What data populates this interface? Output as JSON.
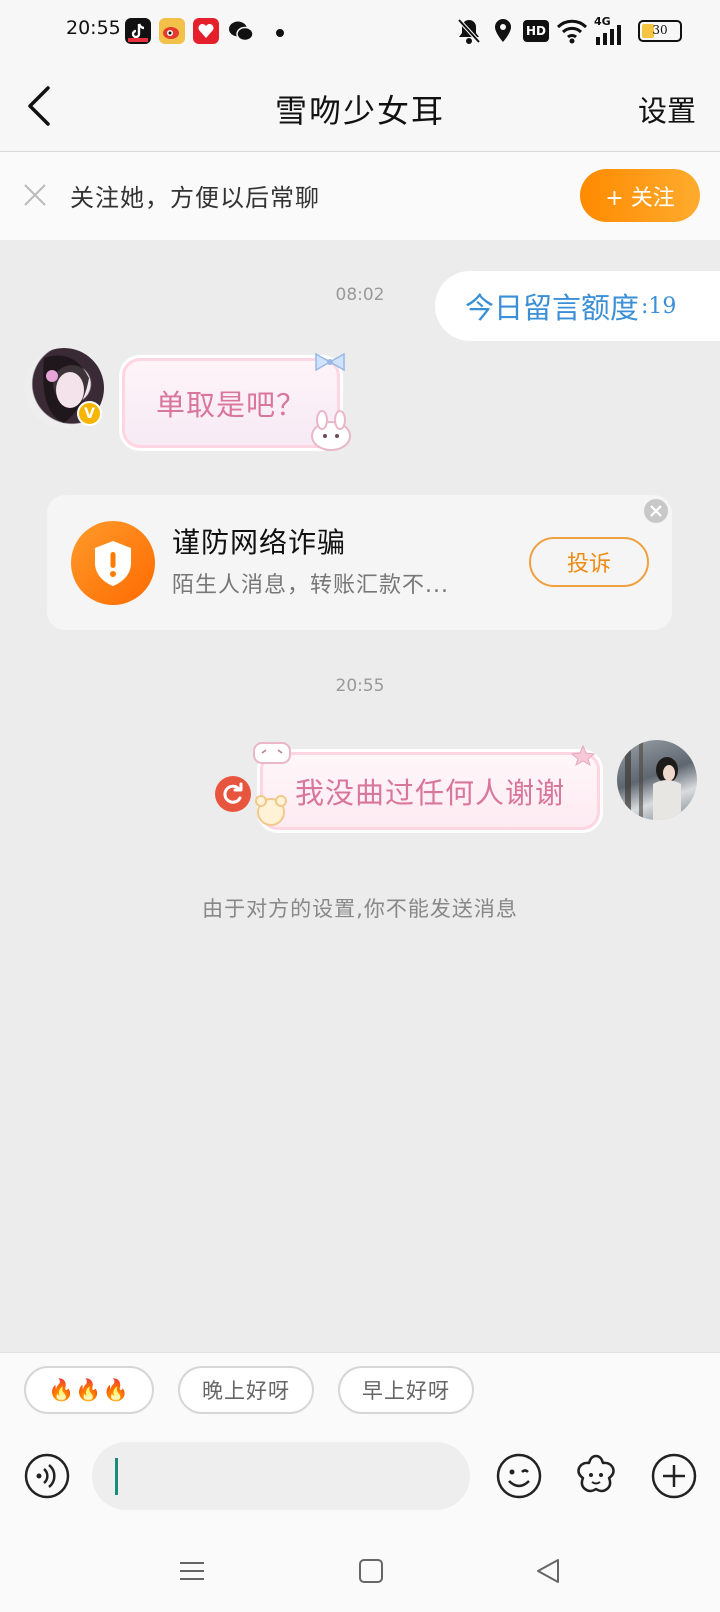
{
  "status_bar": {
    "time": "20:55",
    "battery": "30",
    "network": "4G",
    "hd": "HD"
  },
  "header": {
    "title": "雪吻少女耳",
    "settings_label": "设置"
  },
  "follow_banner": {
    "text": "关注她，方便以后常聊",
    "button_label": "+ 关注"
  },
  "chat": {
    "timestamp_1": "08:02",
    "quota_label": "今日留言额度",
    "quota_count": ":19",
    "incoming_message": "单取是吧？",
    "fraud_card": {
      "title": "谨防网络诈骗",
      "subtitle": "陌生人消息，转账汇款不...",
      "report_label": "投诉"
    },
    "timestamp_2": "20:55",
    "outgoing_message": "我没曲过任何人谢谢",
    "notice": "由于对方的设置,你不能发送消息"
  },
  "quick_replies": [
    "🔥🔥🔥",
    "晚上好呀",
    "早上好呀"
  ],
  "colors": {
    "accent_orange": "#ff8a00",
    "bubble_pink_text": "#d9779b",
    "quota_blue": "#3a8fd6"
  }
}
